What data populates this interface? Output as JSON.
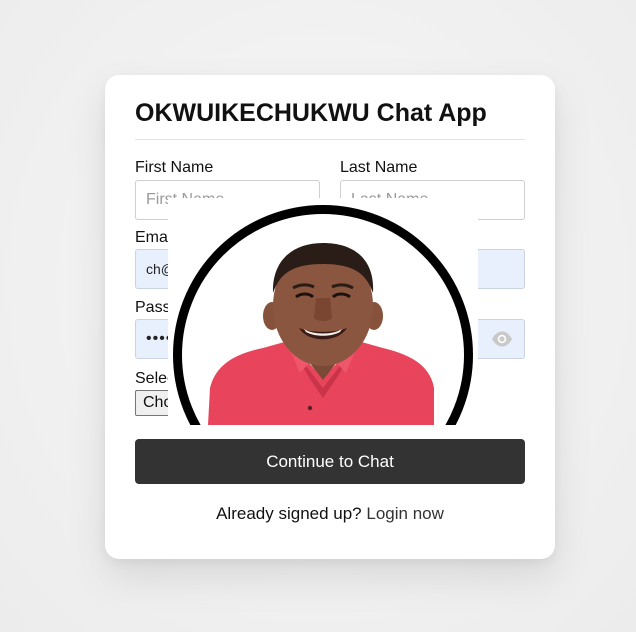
{
  "app": {
    "title": "OKWUIKECHUKWU Chat App"
  },
  "form": {
    "first_name": {
      "label": "First Name",
      "placeholder": "First Name",
      "value": ""
    },
    "last_name": {
      "label": "Last Name",
      "placeholder": "Last Name",
      "value": ""
    },
    "email": {
      "label": "Email Address",
      "value": "ch@"
    },
    "password": {
      "label": "Password",
      "value": "••••••••"
    },
    "image": {
      "label": "Select Image",
      "button_label": "Choose File"
    },
    "submit_label": "Continue to Chat"
  },
  "footer": {
    "text": "Already signed up?",
    "link_label": "Login now"
  },
  "icons": {
    "password_toggle": "eye-icon"
  },
  "colors": {
    "button_bg": "#333333",
    "autofill_bg": "#e8f0fe",
    "card_bg": "#ffffff",
    "avatar_ring": "#000000"
  }
}
